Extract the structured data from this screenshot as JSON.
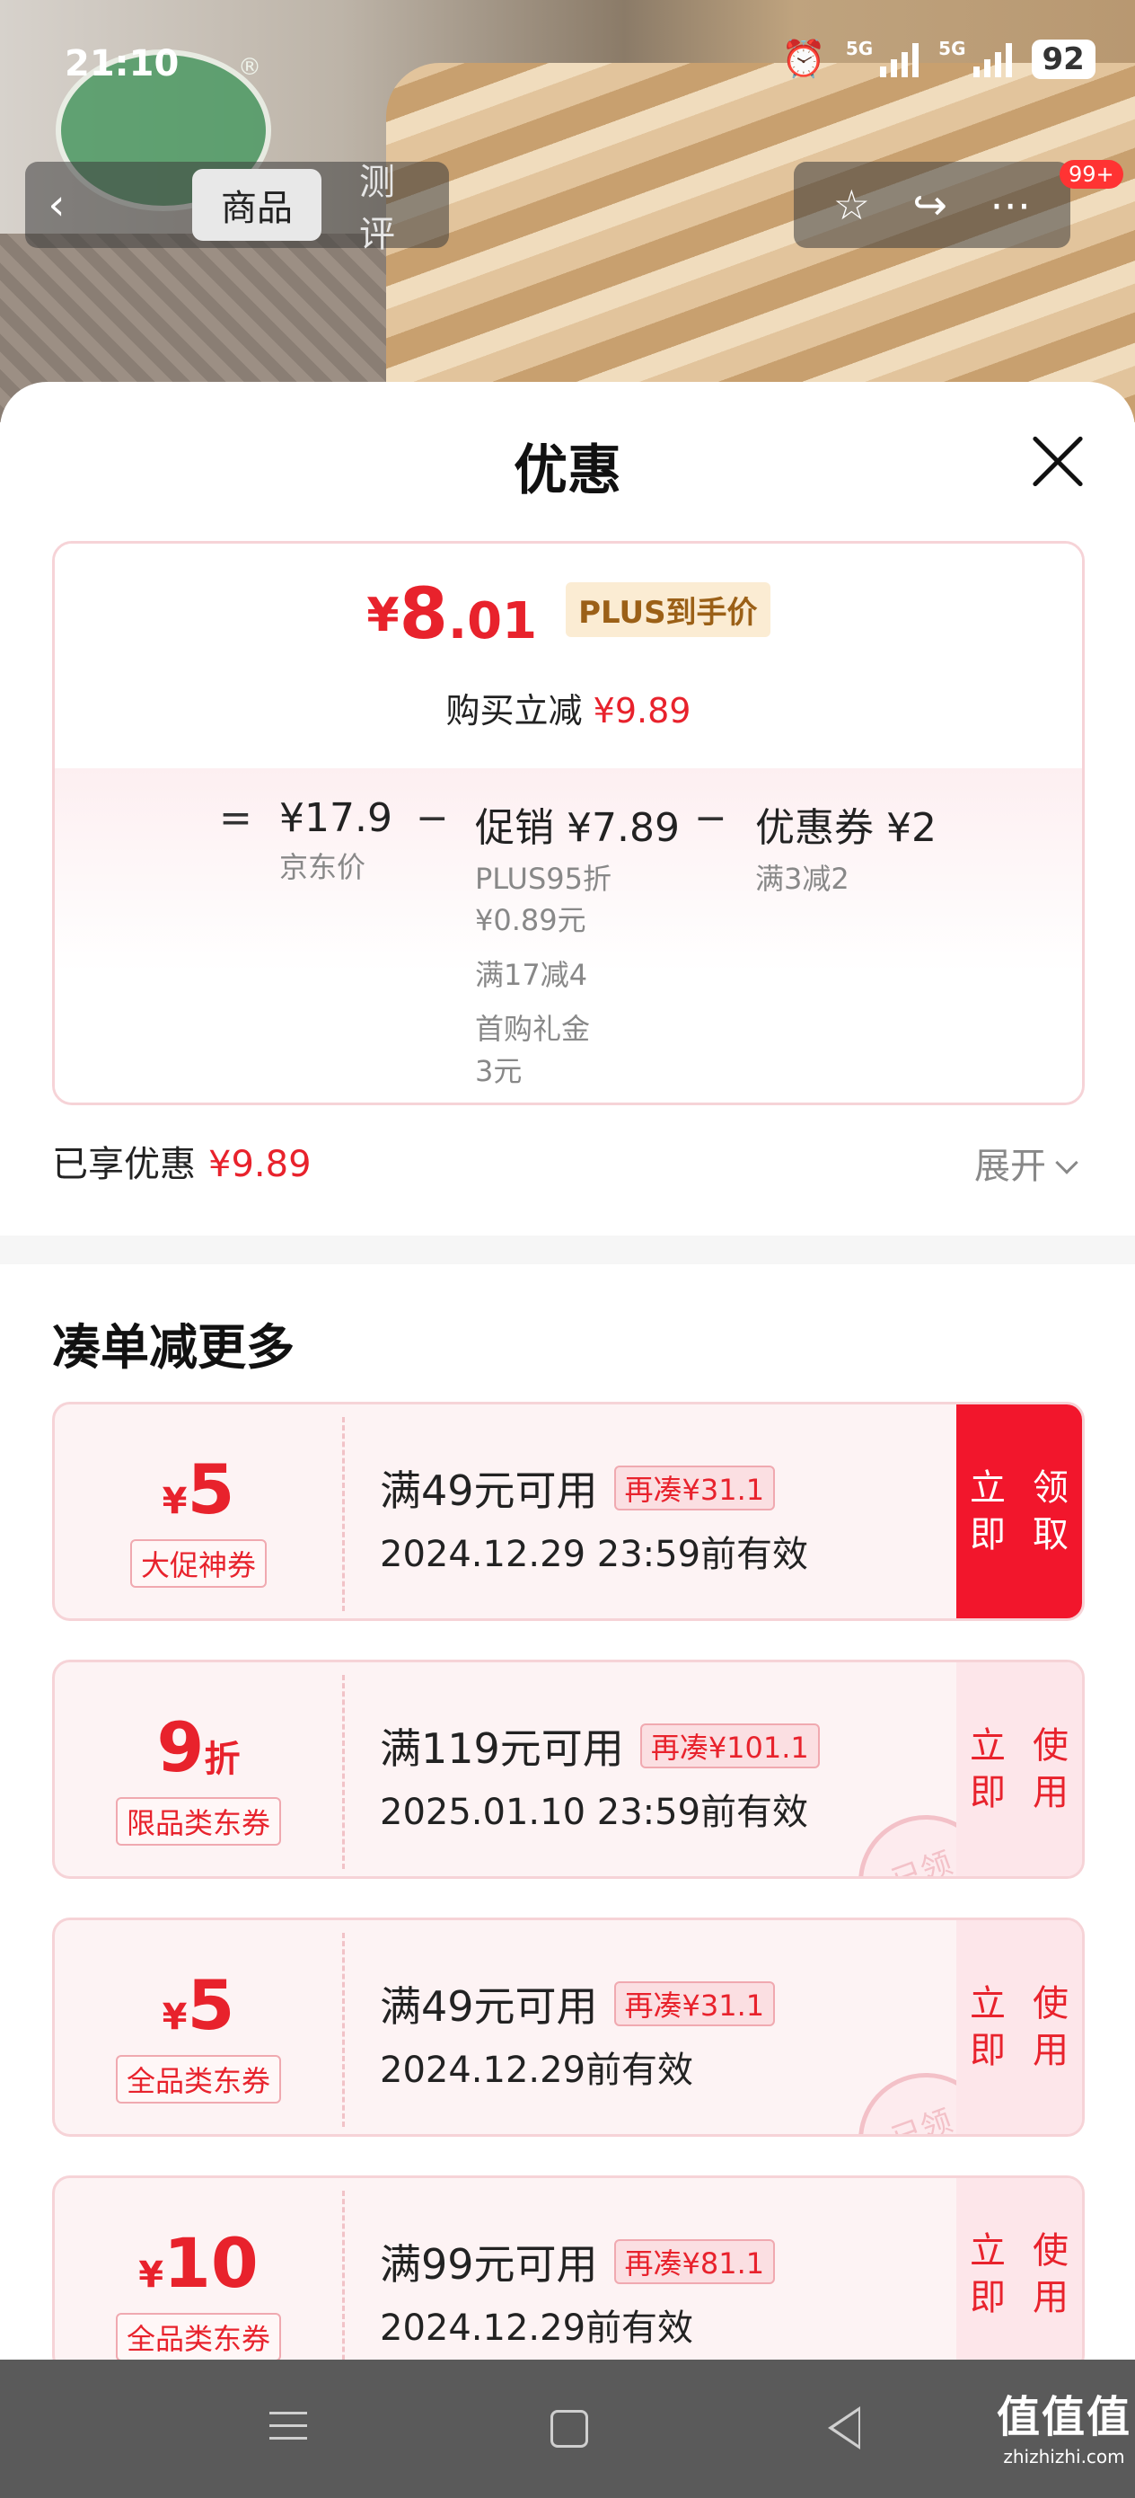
{
  "status_bar": {
    "time": "21:10",
    "battery": "92",
    "net1": "5G",
    "net2": "5G"
  },
  "top_nav": {
    "tab_goods": "商品",
    "tab_reviews": "测评",
    "badge": "99+"
  },
  "sheet": {
    "title": "优惠"
  },
  "price": {
    "symbol": "¥",
    "integer": "8",
    "decimal": ".01",
    "tag": "PLUS到手价",
    "reduce_label": "购买立减",
    "reduce_value": "¥9.89"
  },
  "formula": {
    "equals": "=",
    "minus": "−",
    "jd_price": "¥17.9",
    "jd_price_label": "京东价",
    "promo": "促销 ¥7.89",
    "promo_lines": [
      "PLUS95折",
      "¥0.89元",
      "满17减4",
      "首购礼金",
      "3元"
    ],
    "coupon": "优惠券 ¥2",
    "coupon_line": "满3减2"
  },
  "enjoyed": {
    "label": "已享优惠",
    "value": "¥9.89",
    "expand": "展开"
  },
  "more_section": {
    "title": "凑单减更多"
  },
  "coupons": [
    {
      "symbol": "¥",
      "amount": "5",
      "unit": "",
      "name": "大促神券",
      "condition": "满49元可用",
      "more": "再凑¥31.1",
      "expiry": "2024.12.29 23:59前有效",
      "action": "立即领取",
      "claimed": false
    },
    {
      "symbol": "",
      "amount": "9",
      "unit": "折",
      "name": "限品类东券",
      "condition": "满119元可用",
      "more": "再凑¥101.1",
      "expiry": "2025.01.10 23:59前有效",
      "action": "立即使用",
      "claimed": true
    },
    {
      "symbol": "¥",
      "amount": "5",
      "unit": "",
      "name": "全品类东券",
      "condition": "满49元可用",
      "more": "再凑¥31.1",
      "expiry": "2024.12.29前有效",
      "action": "立即使用",
      "claimed": true
    },
    {
      "symbol": "¥",
      "amount": "10",
      "unit": "",
      "name": "全品类东券",
      "condition": "满99元可用",
      "more": "再凑¥81.1",
      "expiry": "2024.12.29前有效",
      "action": "立即使用",
      "claimed": true
    }
  ],
  "stamp_text": "已领",
  "watermark": {
    "main": "值值值",
    "sub": "zhizhizhi.com"
  },
  "colors": {
    "accent": "#e8222c",
    "claim_button": "#f2162c",
    "plus_tag_bg": "#fbecd3"
  }
}
